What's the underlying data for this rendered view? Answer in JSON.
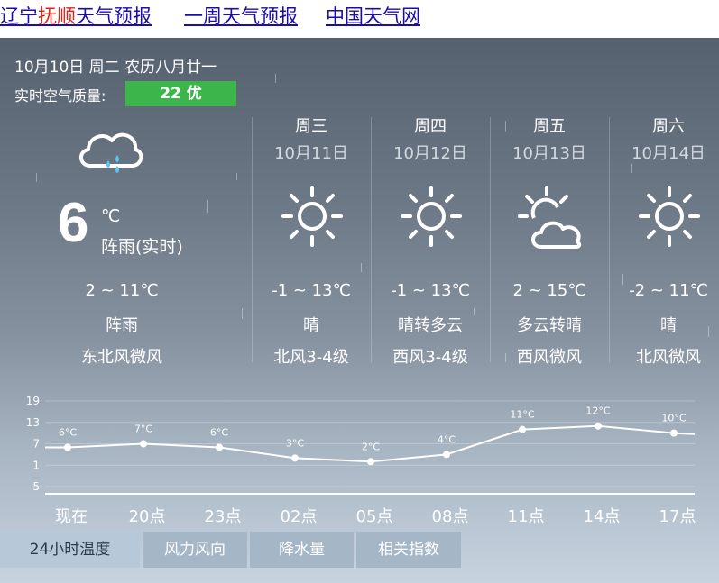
{
  "links": [
    {
      "prefix": "辽宁",
      "highlight": "抚顺",
      "suffix": "天气预报"
    },
    {
      "label": "一周天气预报"
    },
    {
      "label": "中国天气网"
    }
  ],
  "header": {
    "date": "10月10日 周二 农历八月廿一",
    "aqi_label": "实时空气质量:",
    "aqi_value": "22 优",
    "aqi_color": "#3cb54a"
  },
  "today": {
    "icon": "cloud-rain-icon",
    "temp": "6",
    "unit": "℃",
    "condition": "阵雨(实时)",
    "range": "2 ~ 11℃",
    "weather": "阵雨",
    "wind": "东北风微风"
  },
  "forecast": [
    {
      "day": "周三",
      "date": "10月11日",
      "icon": "sun-icon",
      "range": "-1 ~ 13℃",
      "weather": "晴",
      "wind": "北风3-4级"
    },
    {
      "day": "周四",
      "date": "10月12日",
      "icon": "sun-icon",
      "range": "-1 ~ 13℃",
      "weather": "晴转多云",
      "wind": "西风3-4级"
    },
    {
      "day": "周五",
      "date": "10月13日",
      "icon": "sun-cloud-icon",
      "range": "2 ~ 15℃",
      "weather": "多云转晴",
      "wind": "西风微风"
    },
    {
      "day": "周六",
      "date": "10月14日",
      "icon": "sun-icon",
      "range": "-2 ~ 11℃",
      "weather": "晴",
      "wind": "北风微风"
    }
  ],
  "chart_data": {
    "type": "line",
    "categories": [
      "现在",
      "20点",
      "23点",
      "02点",
      "05点",
      "08点",
      "11点",
      "14点",
      "17点"
    ],
    "values": [
      6,
      7,
      6,
      3,
      2,
      4,
      11,
      12,
      10
    ],
    "point_labels": [
      "6°C",
      "7°C",
      "6°C",
      "3°C",
      "2°C",
      "4°C",
      "11°C",
      "12°C",
      "10°C"
    ],
    "yticks": [
      19,
      13,
      7,
      1,
      -5
    ],
    "ylim": [
      -5,
      19
    ]
  },
  "tabs": [
    "24小时温度",
    "风力风向",
    "降水量",
    "相关指数"
  ]
}
